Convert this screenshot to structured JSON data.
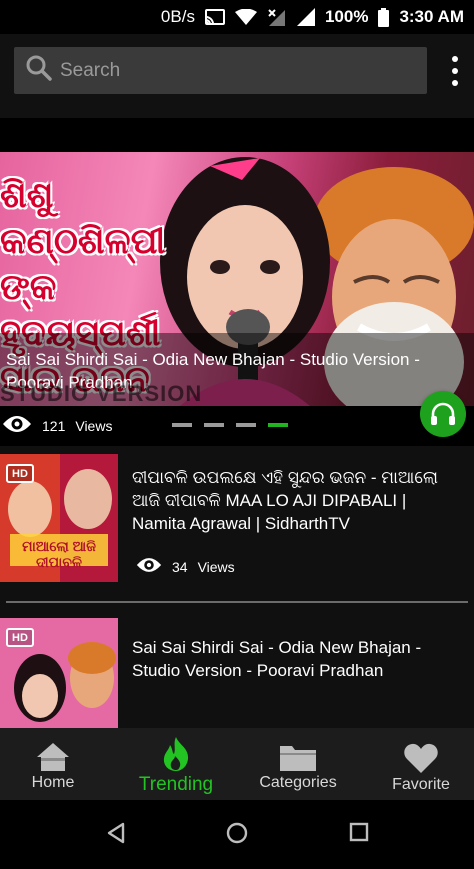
{
  "status_bar": {
    "data_speed": "0B/s",
    "battery": "100%",
    "time": "3:30 AM"
  },
  "search": {
    "placeholder": "Search"
  },
  "hero": {
    "title": "Sai Sai Shirdi Sai - Odia New Bhajan  - Studio Version - Pooravi Pradhan",
    "views": "121",
    "views_label": "Views",
    "overlay_odia": "ଶିଶୁ କଣ୍ଠଶିଳ୍ପୀ ଙ୍କ ହୃଦୟସ୍ପର୍ଶୀ ସାଇ ଭଜନ",
    "watermark": "STUDIO VERSION",
    "slides_total": 4,
    "slide_active": 4
  },
  "videos": [
    {
      "title": "ଦୀପାବଳି ଉପଲକ୍ଷେ ଏହି ସୁନ୍ଦର ଭଜନ - ମାଆଲୋ ଆଜି ଦୀପାବଳି MAA LO AJI DIPABALI | Namita Agrawal | SidharthTV",
      "views": "34",
      "views_label": "Views",
      "badge": "HD",
      "thumb_text": "ମାଆଲୋ ଆଜି ଦୀପାବଳି"
    },
    {
      "title": "Sai Sai Shirdi Sai - Odia New Bhajan  - Studio Version - Pooravi Pradhan",
      "badge": "HD"
    }
  ],
  "bottom_nav": {
    "items": [
      {
        "label": "Home",
        "icon": "home-icon"
      },
      {
        "label": "Trending",
        "icon": "flame-icon"
      },
      {
        "label": "Categories",
        "icon": "folder-icon"
      },
      {
        "label": "Favorite",
        "icon": "heart-icon"
      }
    ],
    "active_index": 1,
    "active_color": "#22c322"
  },
  "colors": {
    "accent_green": "#1ea21e",
    "background": "#000000",
    "card_bg": "#101010"
  }
}
